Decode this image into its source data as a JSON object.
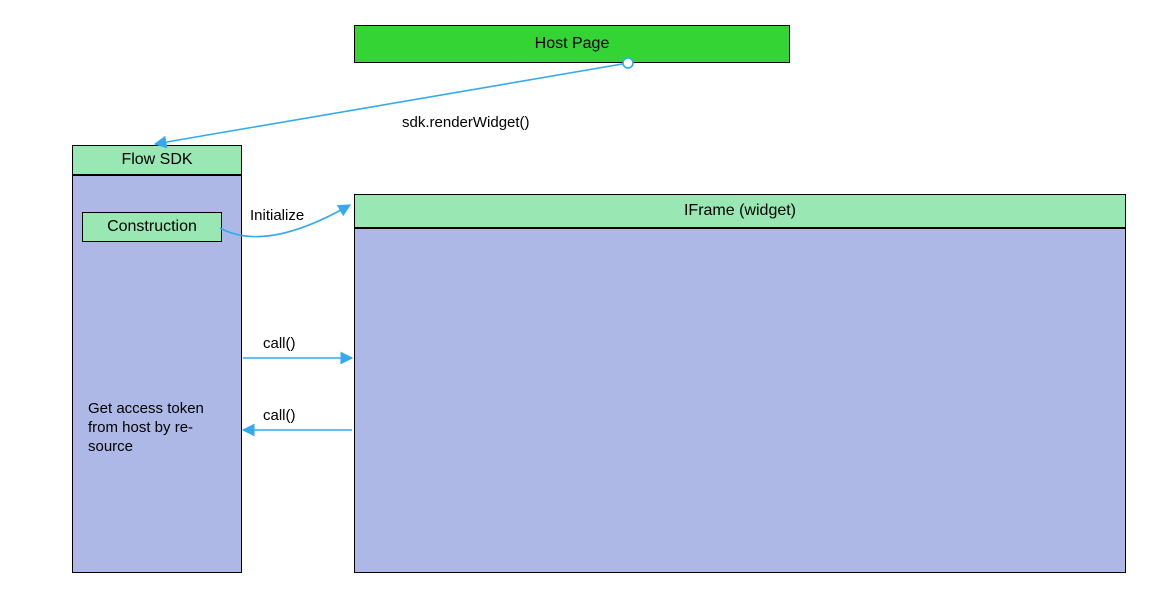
{
  "nodes": {
    "host": {
      "label": "Host Page"
    },
    "sdk_header": {
      "label": "Flow SDK"
    },
    "construction": {
      "label": "Construction"
    },
    "sdk_text": {
      "label": "Get access token from host by re-\nsource"
    },
    "iframe_header": {
      "label": "IFrame (widget)"
    }
  },
  "edges": {
    "render": {
      "label": "sdk.renderWidget()"
    },
    "initialize": {
      "label": "Initialize"
    },
    "call1": {
      "label": "call()"
    },
    "call2": {
      "label": "call()"
    }
  },
  "colors": {
    "green_bright": "#33d433",
    "green_soft": "#99e8b3",
    "lavender": "#adb8e6",
    "arrow": "#33aaf0"
  }
}
